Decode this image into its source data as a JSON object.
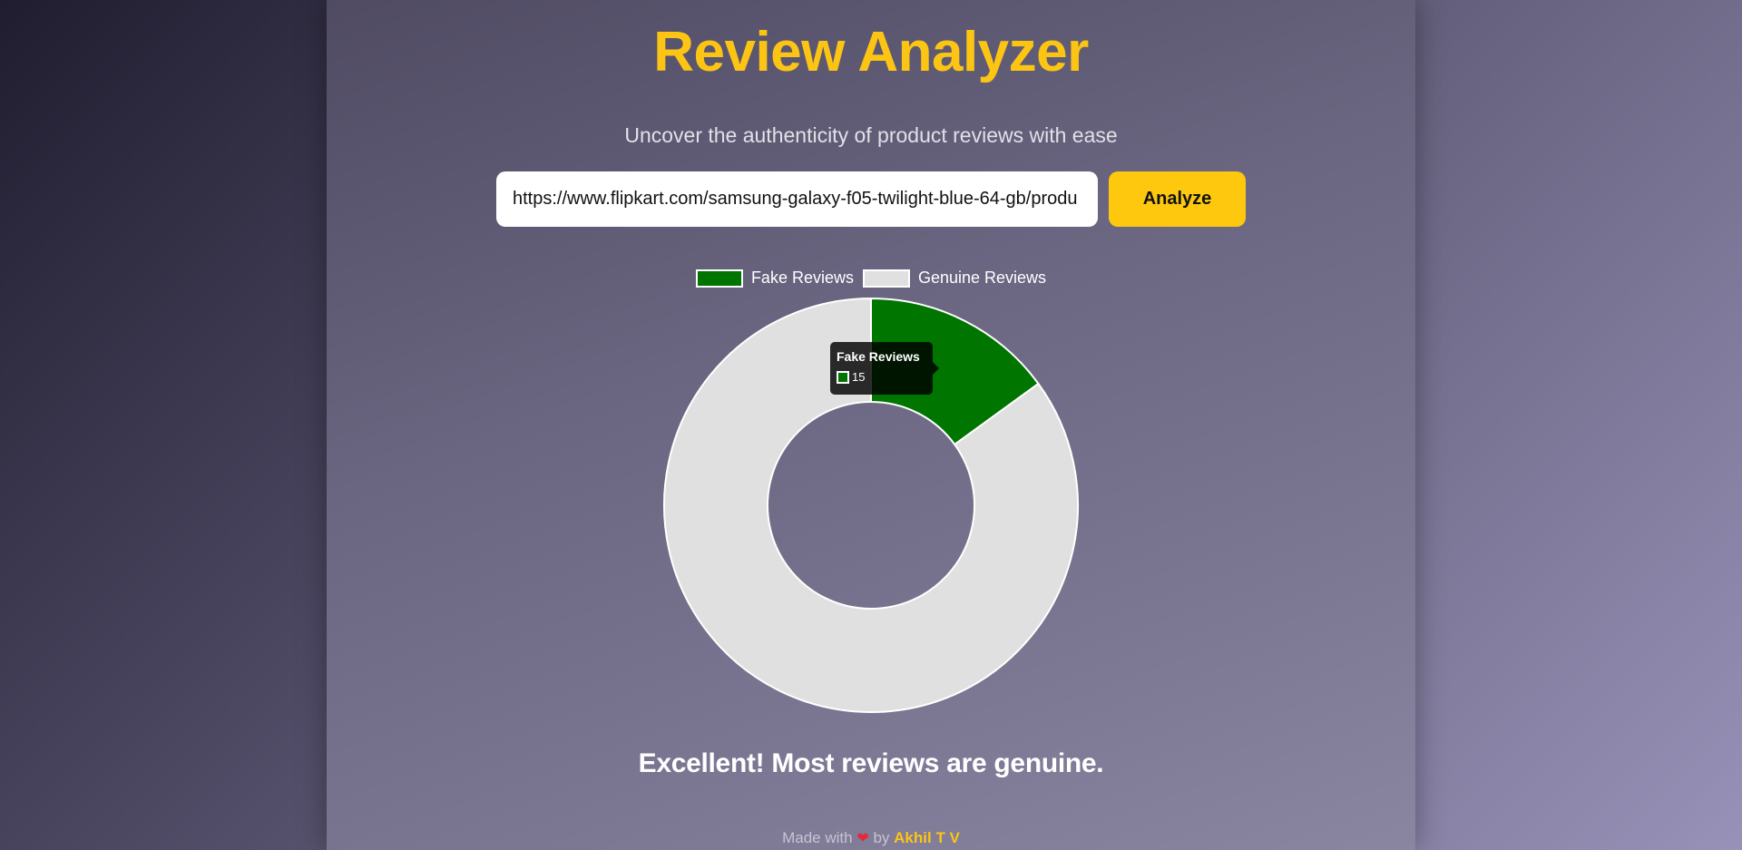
{
  "header": {
    "title": "Review Analyzer",
    "subtitle": "Uncover the authenticity of product reviews with ease"
  },
  "search": {
    "value": "https://www.flipkart.com/samsung-galaxy-f05-twilight-blue-64-gb/produ",
    "button_label": "Analyze"
  },
  "chart_data": {
    "type": "pie",
    "variant": "doughnut",
    "categories": [
      "Fake Reviews",
      "Genuine Reviews"
    ],
    "values": [
      15,
      85
    ],
    "colors": [
      "#007500",
      "#e0e0e0"
    ],
    "legend_position": "top"
  },
  "tooltip": {
    "title": "Fake Reviews",
    "value": "15",
    "color": "#007500"
  },
  "result": {
    "message": "Excellent! Most reviews are genuine."
  },
  "footer": {
    "made_with": "Made with",
    "heart": "❤",
    "by": "by",
    "author": "Akhil T V"
  },
  "colors": {
    "accent": "#fcc514",
    "button": "#fdc80e",
    "fake": "#007500",
    "genuine": "#e0e0e0"
  }
}
